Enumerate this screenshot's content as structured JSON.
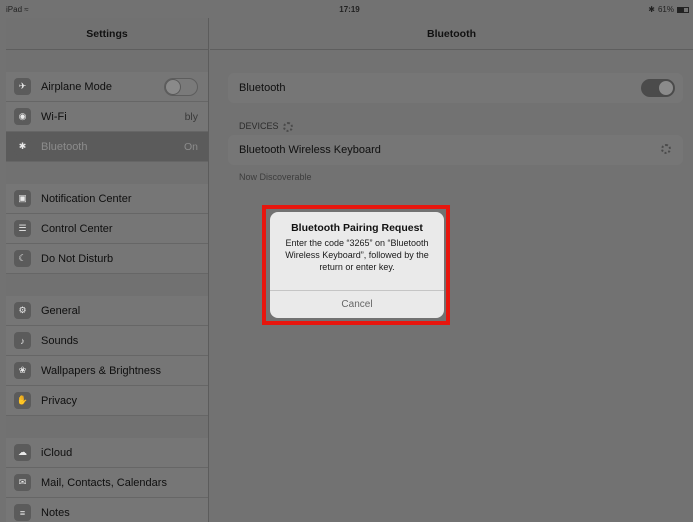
{
  "status_bar": {
    "device": "iPad",
    "time": "17:19",
    "battery": "61%"
  },
  "sidebar": {
    "title": "Settings",
    "items": [
      {
        "label": "Airplane Mode",
        "icon": "airplane-icon"
      },
      {
        "label": "Wi-Fi",
        "value": "bly",
        "icon": "wifi-icon"
      },
      {
        "label": "Bluetooth",
        "value": "On",
        "icon": "bluetooth-icon"
      },
      {
        "label": "Notification Center",
        "icon": "notification-icon"
      },
      {
        "label": "Control Center",
        "icon": "control-center-icon"
      },
      {
        "label": "Do Not Disturb",
        "icon": "moon-icon"
      },
      {
        "label": "General",
        "icon": "gear-icon"
      },
      {
        "label": "Sounds",
        "icon": "speaker-icon"
      },
      {
        "label": "Wallpapers & Brightness",
        "icon": "flower-icon"
      },
      {
        "label": "Privacy",
        "icon": "hand-icon"
      },
      {
        "label": "iCloud",
        "icon": "cloud-icon"
      },
      {
        "label": "Mail, Contacts, Calendars",
        "icon": "mail-icon"
      },
      {
        "label": "Notes",
        "icon": "notes-icon"
      }
    ]
  },
  "detail": {
    "title": "Bluetooth",
    "bluetooth_label": "Bluetooth",
    "devices_label": "DEVICES",
    "device_name": "Bluetooth Wireless Keyboard",
    "discoverable_text": "Now Discoverable"
  },
  "alert": {
    "title": "Bluetooth Pairing Request",
    "message": "Enter the code “3265” on “Bluetooth Wireless Keyboard”, followed by the return or enter key.",
    "cancel_label": "Cancel"
  },
  "colors": {
    "highlight": "#e7160e"
  }
}
